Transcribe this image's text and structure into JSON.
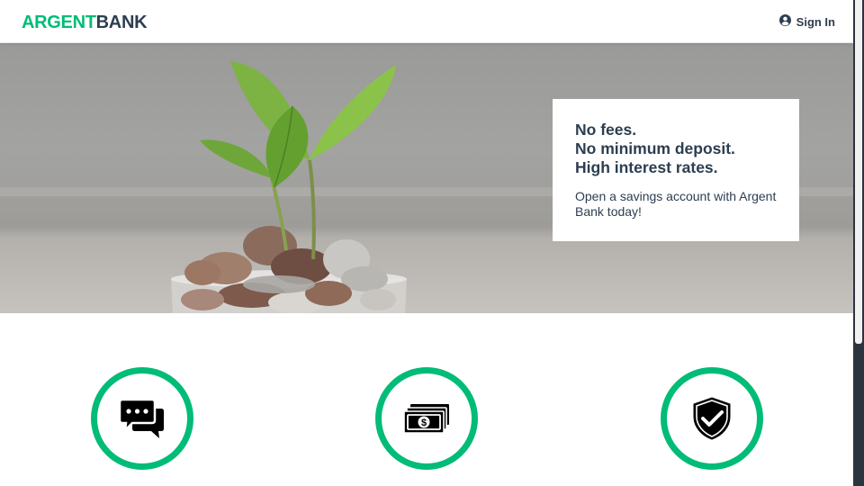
{
  "header": {
    "logo_part1": "ARGENT",
    "logo_part2": "BANK",
    "signin_label": "Sign In",
    "signin_icon": "user-circle-icon"
  },
  "hero": {
    "subtitles": [
      "No fees.",
      "No minimum deposit.",
      "High interest rates."
    ],
    "text": "Open a savings account with Argent Bank today!"
  },
  "features": [
    {
      "icon": "chat-icon"
    },
    {
      "icon": "money-icon"
    },
    {
      "icon": "security-shield-icon"
    }
  ],
  "colors": {
    "brand_green": "#00bc77",
    "text_dark": "#2c3e50"
  }
}
